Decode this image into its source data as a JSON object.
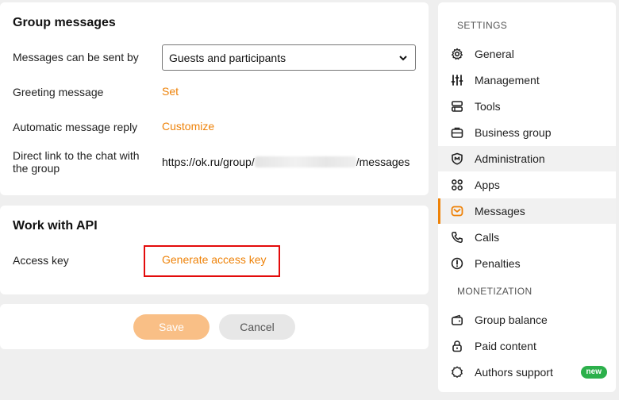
{
  "group_messages": {
    "title": "Group messages",
    "sent_by_label": "Messages can be sent by",
    "sent_by_value": "Guests and participants",
    "greeting_label": "Greeting message",
    "greeting_action": "Set",
    "auto_reply_label": "Automatic message reply",
    "auto_reply_action": "Customize",
    "direct_link_label_line1": "Direct link to the chat with",
    "direct_link_label_line2": "the group",
    "direct_link_prefix": "https://ok.ru/group/",
    "direct_link_suffix": "/messages"
  },
  "api": {
    "title": "Work with API",
    "access_key_label": "Access key",
    "generate_action": "Generate access key"
  },
  "actions": {
    "save_label": "Save",
    "cancel_label": "Cancel"
  },
  "sidebar": {
    "settings_title": "SETTINGS",
    "settings_items": [
      {
        "label": "General",
        "icon": "gear-icon"
      },
      {
        "label": "Management",
        "icon": "sliders-icon"
      },
      {
        "label": "Tools",
        "icon": "tools-icon"
      },
      {
        "label": "Business group",
        "icon": "briefcase-icon"
      },
      {
        "label": "Administration",
        "icon": "shield-icon"
      },
      {
        "label": "Apps",
        "icon": "apps-grid-icon"
      },
      {
        "label": "Messages",
        "icon": "envelope-icon"
      },
      {
        "label": "Calls",
        "icon": "phone-icon"
      },
      {
        "label": "Penalties",
        "icon": "warning-circle-icon"
      }
    ],
    "monetization_title": "MONETIZATION",
    "monetization_items": [
      {
        "label": "Group balance",
        "icon": "wallet-icon"
      },
      {
        "label": "Paid content",
        "icon": "lock-icon"
      },
      {
        "label": "Authors support",
        "icon": "badge-gear-icon",
        "badge": "new"
      }
    ]
  },
  "colors": {
    "accent": "#ee8208",
    "highlight_border": "#e30b0b",
    "badge_green": "#2cb04b",
    "save_button": "#f9bf86"
  }
}
